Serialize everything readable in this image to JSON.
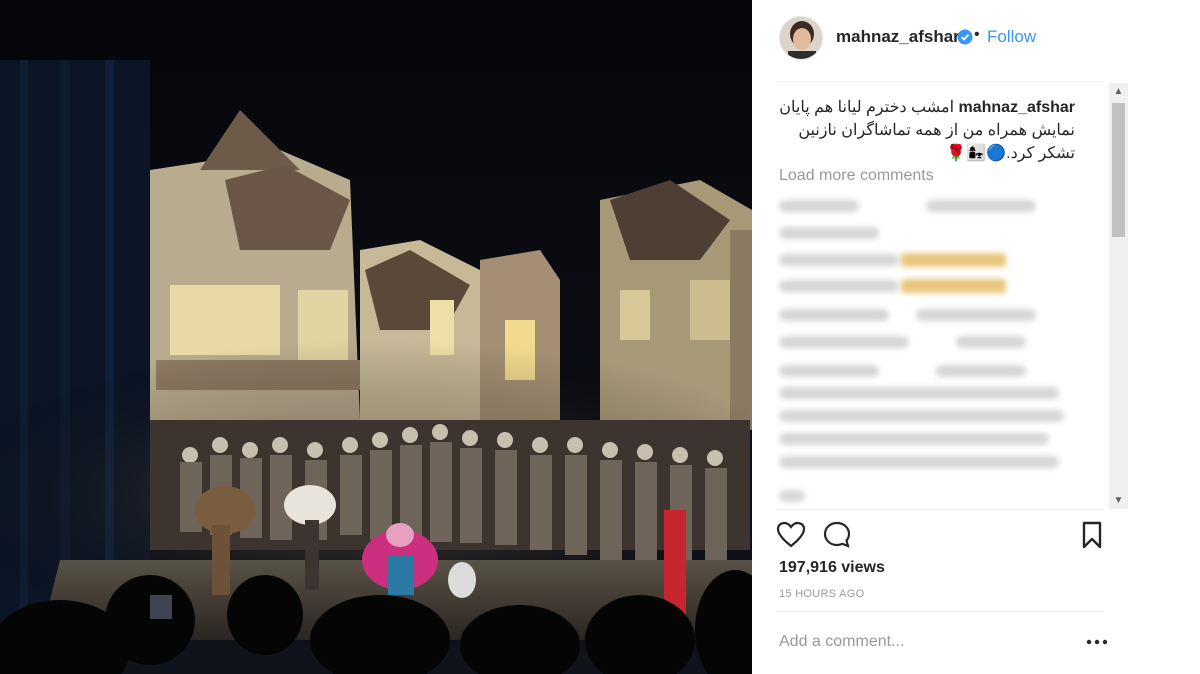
{
  "post": {
    "username": "mahnaz_afshar",
    "follow_label": "Follow",
    "separator_dot": "•",
    "caption_user": "mahnaz_afshar",
    "caption_text": "امشب دخترم لیانا هم پایان نمایش همراه من از همه تماشاگران نازنین تشکر کرد.🔵👩‍👧🌹",
    "load_more_label": "Load more comments",
    "views": "197,916 views",
    "time_ago": "15 HOURS AGO",
    "add_comment_placeholder": "Add a comment..."
  },
  "scrollbar": {
    "up_arrow": "▲",
    "down_arrow": "▼"
  },
  "icons": {
    "like": "heart-icon",
    "comment": "comment-bubble-icon",
    "save": "bookmark-icon",
    "more": "more-options-icon",
    "verified": "verified-badge-icon"
  },
  "colors": {
    "link_blue": "#3897f0",
    "text_dark": "#262626",
    "text_muted": "#999999"
  }
}
